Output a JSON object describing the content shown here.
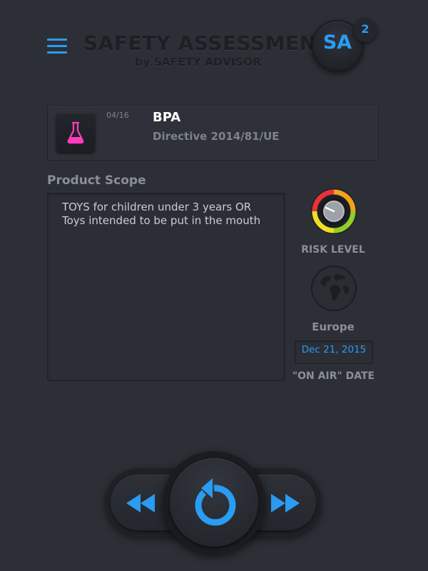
{
  "header": {
    "menu_icon": "hamburger-menu-icon",
    "title": "SAFETY ASSESSMENT",
    "subtitle": "by SAFETY ADVISOR",
    "logo_text": "SA",
    "logo_badge": "2",
    "accent_color": "#2a9cf2"
  },
  "substance": {
    "icon": "flask-icon",
    "icon_color": "#ff3dbd",
    "counter": "04/16",
    "name": "BPA",
    "directive": "Directive 2014/81/UE"
  },
  "scope": {
    "heading": "Product Scope",
    "text": "TOYS for children under 3 years OR Toys intended to be put in the mouth"
  },
  "sidebar": {
    "risk_icon": "risk-gauge-icon",
    "risk_label": "RISK LEVEL",
    "region_icon": "globe-icon",
    "region": "Europe",
    "date": "Dec 21, 2015",
    "date_label": "\"ON AIR\" DATE"
  },
  "controls": {
    "previous_icon": "rewind-icon",
    "reload_icon": "refresh-icon",
    "next_icon": "fast-forward-icon"
  }
}
